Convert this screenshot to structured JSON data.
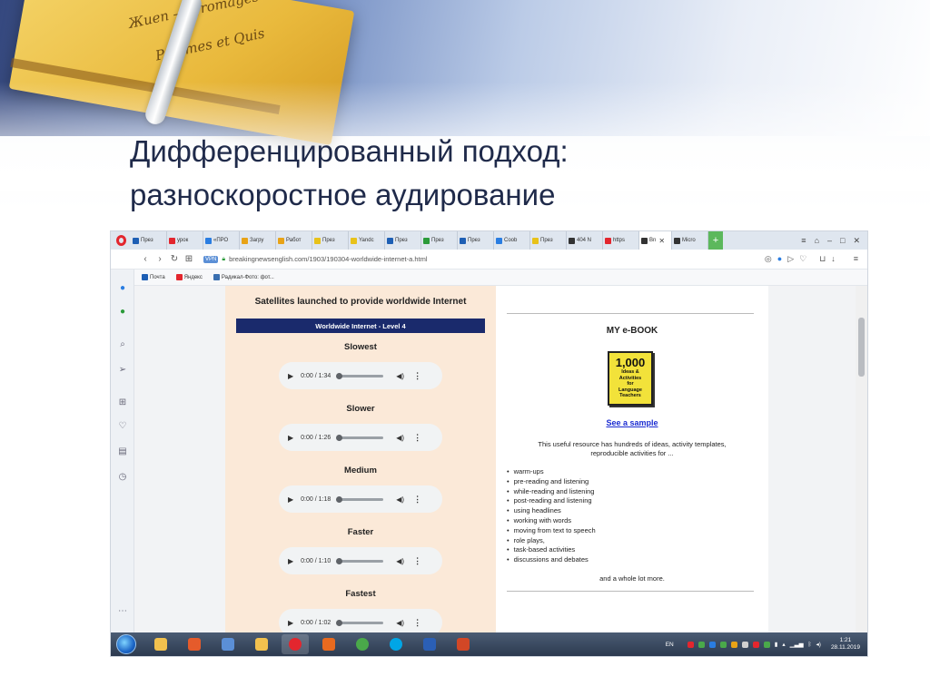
{
  "slide": {
    "title_line1": "Дифференцированный подход:",
    "title_line2": "разноскоростное аудирование"
  },
  "browser": {
    "tabs": [
      {
        "label": "През",
        "color": "#1e5fb4"
      },
      {
        "label": "урок",
        "color": "#e3262e"
      },
      {
        "label": "«ПРО",
        "color": "#2a7de1"
      },
      {
        "label": "Загру",
        "color": "#e8a317"
      },
      {
        "label": "Работ",
        "color": "#e8a317"
      },
      {
        "label": "През",
        "color": "#e8c21a"
      },
      {
        "label": "Yandc",
        "color": "#e8c21a"
      },
      {
        "label": "През",
        "color": "#1e5fb4"
      },
      {
        "label": "През",
        "color": "#2b9b3a"
      },
      {
        "label": "През",
        "color": "#1e5fb4"
      },
      {
        "label": "Coob",
        "color": "#2a7de1"
      },
      {
        "label": "През",
        "color": "#e8c21a"
      },
      {
        "label": "404 N",
        "color": "#333333"
      },
      {
        "label": "https",
        "color": "#e3262e"
      },
      {
        "label": "Bn",
        "color": "#333333",
        "active": true
      },
      {
        "label": "Micro",
        "color": "#333333"
      }
    ],
    "new_tab_label": "+",
    "url": "breakingnewsenglish.com/1903/190304-worldwide-internet-a.html",
    "vpn_label": "VPN",
    "bookmarks": [
      {
        "label": "Почта",
        "color": "#1e5fb4"
      },
      {
        "label": "Яндекс",
        "color": "#e3262e"
      },
      {
        "label": "Радикал-Фото: фот...",
        "color": "#3a6fb0"
      }
    ]
  },
  "article": {
    "title": "Satellites launched to provide worldwide Internet",
    "level": "Worldwide Internet - Level 4",
    "speeds": [
      {
        "label": "Slowest",
        "time": "0:00 / 1:34"
      },
      {
        "label": "Slower",
        "time": "0:00 / 1:26"
      },
      {
        "label": "Medium",
        "time": "0:00 / 1:18"
      },
      {
        "label": "Faster",
        "time": "0:00 / 1:10"
      },
      {
        "label": "Fastest",
        "time": "0:00 / 1:02"
      }
    ]
  },
  "ebook": {
    "title": "MY e-BOOK",
    "cover_number": "1,000",
    "cover_line1": "Ideas &",
    "cover_line2": "Activities",
    "cover_line3": "for",
    "cover_line4": "Language",
    "cover_line5": "Teachers",
    "sample_link": "See a sample",
    "description_line1": "This useful resource has hundreds of ideas, activity templates,",
    "description_line2": "reproducible activities for ...",
    "features": [
      "warm-ups",
      "pre-reading and listening",
      "while-reading and listening",
      "post-reading and listening",
      "using headlines",
      "working with words",
      "moving from text to speech",
      "role plays,",
      "task-based activities",
      "discussions and debates"
    ],
    "more": "and a whole lot more."
  },
  "taskbar": {
    "apps": [
      {
        "name": "explorer",
        "color": "#f2c14e"
      },
      {
        "name": "media",
        "color": "#e55b2b"
      },
      {
        "name": "file",
        "color": "#5b8fd6"
      },
      {
        "name": "folder",
        "color": "#f2c14e"
      },
      {
        "name": "opera",
        "color": "#e3262e",
        "active": true
      },
      {
        "name": "app-orange",
        "color": "#e86a1f"
      },
      {
        "name": "chrome",
        "color": "#4aa94a"
      },
      {
        "name": "skype",
        "color": "#00a6e6"
      },
      {
        "name": "word",
        "color": "#2b5fb5"
      },
      {
        "name": "powerpoint",
        "color": "#d24726"
      }
    ],
    "lang": "EN",
    "time": "1:21",
    "date": "28.11.2019"
  }
}
